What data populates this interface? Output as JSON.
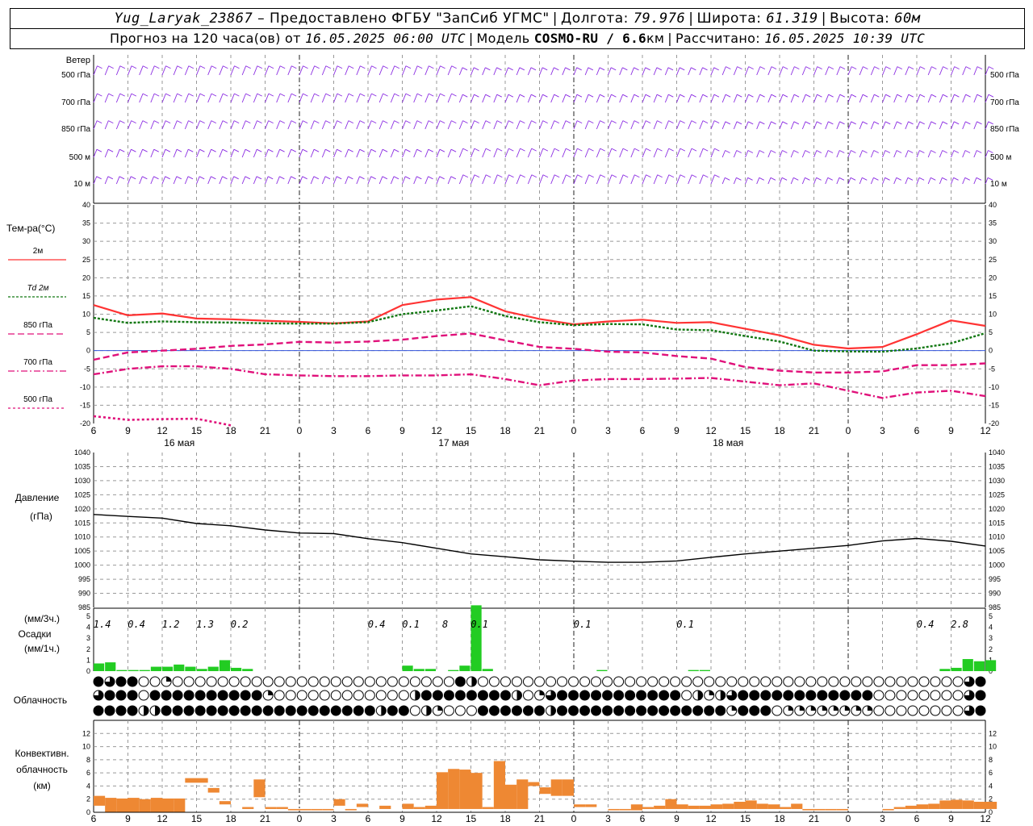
{
  "header": {
    "station": "Yug_Laryak_23867",
    "dash": "–",
    "provider": "Предоставлено ФГБУ \"ЗапСиб УГМС\"",
    "lon_label": "Долгота:",
    "lon": "79.976",
    "lat_label": "Широта:",
    "lat": "61.319",
    "alt_label": "Высота:",
    "alt": "60м",
    "forecast_label": "Прогноз на 120 часа(ов) от",
    "forecast_time": "16.05.2025 06:00 UTC",
    "model_label": "Модель",
    "model": "COSMO-RU / 6.6",
    "model_unit": "км",
    "calc_label": "Рассчитано:",
    "calc_time": "16.05.2025 10:39 UTC"
  },
  "x_axis": {
    "hour_ticks": [
      "6",
      "9",
      "12",
      "15",
      "18",
      "21",
      "0",
      "3",
      "6",
      "9",
      "12",
      "15",
      "18",
      "21",
      "0",
      "3",
      "6",
      "9",
      "12",
      "15",
      "18",
      "21",
      "0",
      "3",
      "6",
      "9",
      "12"
    ],
    "dates": [
      "16 мая",
      "17 мая",
      "18 мая"
    ]
  },
  "colors": {
    "wind": "#8a2be2",
    "temp_2m": "#ff3333",
    "td_2m": "#127812",
    "t850": "#e0107a",
    "precip": "#22cc22",
    "conv": "#ee8833",
    "grid": "#999999"
  },
  "chart_data": [
    {
      "type": "wind_barbs",
      "title": "Ветер",
      "levels": [
        "500 гПа",
        "700 гПа",
        "850 гПа",
        "500 м",
        "10 м"
      ]
    },
    {
      "type": "line",
      "title": "",
      "ylabel": "Тем-ра(°C)",
      "ylim": [
        -20,
        40
      ],
      "y_ticks": [
        "40",
        "35",
        "30",
        "25",
        "20",
        "15",
        "10",
        "5",
        "0",
        "-5",
        "-10",
        "-15",
        "-20"
      ],
      "x_hours": [
        0,
        3,
        6,
        9,
        12,
        15,
        18,
        21,
        24,
        27,
        30,
        33,
        36,
        39,
        42,
        45,
        48,
        51,
        54,
        57,
        60,
        63,
        66,
        69,
        72,
        75,
        78
      ],
      "series": [
        {
          "name": "2м",
          "values": [
            12.5,
            9.7,
            10.2,
            8.8,
            8.6,
            8.2,
            7.9,
            7.5,
            8.0,
            12.5,
            14.0,
            14.7,
            10.8,
            8.7,
            7.2,
            8.0,
            8.5,
            7.6,
            7.8,
            6.0,
            4.2,
            1.6,
            0.6,
            1.0,
            4.5,
            8.3,
            6.8
          ]
        },
        {
          "name": "Td 2м",
          "values": [
            9.0,
            7.6,
            8.0,
            7.8,
            7.7,
            7.5,
            7.4,
            7.4,
            7.8,
            10.0,
            11.0,
            12.2,
            9.5,
            7.8,
            7.0,
            7.3,
            7.2,
            5.8,
            5.6,
            4.0,
            2.5,
            0.0,
            -0.2,
            -0.3,
            0.6,
            2.0,
            4.8
          ]
        },
        {
          "name": "850 гПа",
          "values": [
            -2.5,
            -0.5,
            0.0,
            0.5,
            1.3,
            1.7,
            2.4,
            2.2,
            2.5,
            3.0,
            4.0,
            4.7,
            2.8,
            1.0,
            0.5,
            -0.3,
            -0.5,
            -1.5,
            -2.2,
            -4.5,
            -5.5,
            -6.0,
            -6.0,
            -5.7,
            -4.0,
            -4.0,
            -3.5
          ]
        },
        {
          "name": "700 гПа",
          "values": [
            -6.5,
            -5.0,
            -4.3,
            -4.3,
            -5.0,
            -6.5,
            -6.8,
            -7.0,
            -7.0,
            -6.8,
            -6.8,
            -6.5,
            -7.8,
            -9.5,
            -8.2,
            -7.8,
            -7.8,
            -7.7,
            -7.5,
            -8.5,
            -9.5,
            -9.0,
            -11.0,
            -13.0,
            -11.5,
            -11.0,
            -12.5
          ]
        },
        {
          "name": "500 гПа",
          "values": [
            -18.0,
            -19.0,
            -18.8,
            -18.7,
            -20.5,
            null,
            null,
            null,
            null,
            null,
            null,
            null,
            null,
            null,
            null,
            null,
            null,
            null,
            null,
            null,
            null,
            null,
            null,
            null,
            null,
            null,
            null
          ]
        }
      ]
    },
    {
      "type": "line",
      "title": "",
      "ylabel": "Давление",
      "yunit": "(гПа)",
      "ylim": [
        985,
        1040
      ],
      "y_ticks": [
        "1040",
        "1035",
        "1030",
        "1025",
        "1020",
        "1015",
        "1010",
        "1005",
        "1000",
        "995",
        "990",
        "985"
      ],
      "x_hours": [
        0,
        3,
        6,
        9,
        12,
        15,
        18,
        21,
        24,
        27,
        30,
        33,
        36,
        39,
        42,
        45,
        48,
        51,
        54,
        57,
        60,
        63,
        66,
        69,
        72,
        75,
        78
      ],
      "values": [
        1018,
        1017.3,
        1016.7,
        1014.8,
        1014,
        1012.5,
        1011.4,
        1011.2,
        1009.4,
        1008,
        1006,
        1004,
        1003,
        1001.9,
        1001.4,
        1001,
        1001,
        1001.5,
        1002.8,
        1004,
        1005,
        1006,
        1007,
        1008.6,
        1009.5,
        1008.5,
        1006.8
      ]
    },
    {
      "type": "bar",
      "title": "",
      "ylabel": "Осадки",
      "yunit_3h": "(мм/3ч.)",
      "yunit_1h": "(мм/1ч.)",
      "ylim": [
        0,
        5
      ],
      "y_ticks": [
        "5",
        "4",
        "3",
        "2",
        "1",
        "0"
      ],
      "hourly_values": [
        0.7,
        0.8,
        0.1,
        0.1,
        0.1,
        0.4,
        0.4,
        0.6,
        0.4,
        0.2,
        0.4,
        1.0,
        0.3,
        0.2,
        0,
        0,
        0,
        0,
        0,
        0,
        0,
        0,
        0,
        0,
        0,
        0,
        0,
        0.5,
        0.2,
        0.2,
        0,
        0.1,
        0.5,
        6.1,
        0.2,
        0,
        0,
        0,
        0,
        0,
        0,
        0,
        0,
        0,
        0.1,
        0,
        0,
        0,
        0,
        0,
        0,
        0,
        0.1,
        0.1,
        0,
        0,
        0,
        0,
        0,
        0,
        0,
        0,
        0,
        0,
        0,
        0,
        0,
        0,
        0,
        0,
        0,
        0,
        0,
        0,
        0.2,
        0.3,
        1.1,
        0.9,
        1.0
      ],
      "labels_3h": [
        {
          "hour": 0.75,
          "text": "1.4"
        },
        {
          "hour": 3.75,
          "text": "0.4"
        },
        {
          "hour": 6.75,
          "text": "1.2"
        },
        {
          "hour": 9.75,
          "text": "1.3"
        },
        {
          "hour": 12.75,
          "text": "0.2"
        },
        {
          "hour": 24.75,
          "text": "0.4"
        },
        {
          "hour": 27.75,
          "text": "0.1"
        },
        {
          "hour": 30.75,
          "text": "8"
        },
        {
          "hour": 33.75,
          "text": "0.1"
        },
        {
          "hour": 42.75,
          "text": "0.1"
        },
        {
          "hour": 51.75,
          "text": "0.1"
        },
        {
          "hour": 72.75,
          "text": "0.4"
        },
        {
          "hour": 75.75,
          "text": "2.8"
        }
      ]
    },
    {
      "type": "table",
      "title": "Облачность",
      "rows": [
        [
          8,
          6,
          8,
          8,
          0,
          0,
          2,
          0,
          0,
          0,
          0,
          0,
          0,
          0,
          0,
          0,
          0,
          0,
          0,
          0,
          0,
          0,
          0,
          0,
          0,
          0,
          0,
          0,
          0,
          0,
          0,
          0,
          8,
          4,
          0,
          0,
          0,
          0,
          0,
          0,
          0,
          0,
          0,
          0,
          0,
          0,
          0,
          0,
          0,
          0,
          0,
          0,
          0,
          0,
          0,
          0,
          0,
          0,
          0,
          0,
          0,
          0,
          0,
          0,
          0,
          0,
          0,
          0,
          0,
          0,
          0,
          0,
          0,
          0,
          0,
          0,
          0,
          6,
          8,
          0,
          0,
          0,
          0,
          0,
          0,
          0,
          0,
          0
        ],
        [
          6,
          8,
          8,
          8,
          0,
          8,
          8,
          8,
          8,
          8,
          8,
          8,
          8,
          8,
          8,
          2,
          0,
          0,
          0,
          0,
          0,
          0,
          0,
          0,
          0,
          0,
          0,
          0,
          4,
          8,
          8,
          8,
          8,
          8,
          8,
          8,
          8,
          4,
          0,
          2,
          6,
          8,
          8,
          8,
          8,
          8,
          8,
          8,
          8,
          8,
          8,
          8,
          0,
          4,
          2,
          4,
          6,
          8,
          8,
          8,
          8,
          8,
          8,
          8,
          8,
          8,
          8,
          8,
          8,
          0,
          0,
          0,
          0,
          0,
          0,
          0,
          0,
          6,
          8,
          8,
          8,
          8,
          8,
          8,
          8,
          8,
          8,
          8
        ],
        [
          8,
          8,
          8,
          8,
          4,
          4,
          8,
          8,
          8,
          8,
          8,
          8,
          8,
          8,
          8,
          8,
          8,
          8,
          8,
          8,
          8,
          8,
          8,
          8,
          8,
          4,
          8,
          8,
          0,
          4,
          2,
          0,
          0,
          0,
          8,
          8,
          8,
          8,
          8,
          8,
          4,
          8,
          8,
          8,
          8,
          8,
          8,
          8,
          8,
          8,
          8,
          8,
          8,
          8,
          8,
          8,
          2,
          8,
          8,
          8,
          0,
          2,
          2,
          2,
          2,
          2,
          2,
          2,
          2,
          0,
          0,
          0,
          0,
          0,
          0,
          0,
          0,
          6,
          8,
          8,
          8,
          8,
          8,
          8,
          8,
          8,
          8,
          8
        ]
      ]
    },
    {
      "type": "bar",
      "title": "",
      "ylabel": "Конвективн. облачность",
      "yunit": "(км)",
      "ylim": [
        0,
        14
      ],
      "y_ticks": [
        "12",
        "10",
        "8",
        "6",
        "4",
        "2",
        "0"
      ],
      "bars": [
        {
          "h": 0,
          "base": 1.0,
          "top": 2.5
        },
        {
          "h": 1,
          "base": 0,
          "top": 2.2
        },
        {
          "h": 2,
          "base": 0,
          "top": 2.1
        },
        {
          "h": 3,
          "base": 0,
          "top": 2.2
        },
        {
          "h": 4,
          "base": 0,
          "top": 2.0
        },
        {
          "h": 5,
          "base": 0,
          "top": 2.2
        },
        {
          "h": 6,
          "base": 0,
          "top": 2.1
        },
        {
          "h": 7,
          "base": 0,
          "top": 2.1
        },
        {
          "h": 8,
          "base": 4.5,
          "top": 5.2
        },
        {
          "h": 9,
          "base": 4.5,
          "top": 5.2
        },
        {
          "h": 10,
          "base": 3.0,
          "top": 3.7
        },
        {
          "h": 11,
          "base": 1.2,
          "top": 1.7
        },
        {
          "h": 13,
          "base": 0.5,
          "top": 0.8
        },
        {
          "h": 14,
          "base": 2.3,
          "top": 5.0
        },
        {
          "h": 15,
          "base": 0.5,
          "top": 0.8
        },
        {
          "h": 16,
          "base": 0.5,
          "top": 0.8
        },
        {
          "h": 17,
          "base": 0.3,
          "top": 0.5
        },
        {
          "h": 18,
          "base": 0.3,
          "top": 0.5
        },
        {
          "h": 19,
          "base": 0.3,
          "top": 0.5
        },
        {
          "h": 20,
          "base": 0.3,
          "top": 0.5
        },
        {
          "h": 21,
          "base": 1.0,
          "top": 2.0
        },
        {
          "h": 22,
          "base": 0.3,
          "top": 0.5
        },
        {
          "h": 23,
          "base": 0.8,
          "top": 1.3
        },
        {
          "h": 25,
          "base": 0.5,
          "top": 1.0
        },
        {
          "h": 27,
          "base": 0.5,
          "top": 1.3
        },
        {
          "h": 28,
          "base": 0.5,
          "top": 0.8
        },
        {
          "h": 29,
          "base": 0.5,
          "top": 1.0
        },
        {
          "h": 30,
          "base": 0.5,
          "top": 6.1
        },
        {
          "h": 31,
          "base": 0.5,
          "top": 6.6
        },
        {
          "h": 32,
          "base": 0.5,
          "top": 6.5
        },
        {
          "h": 33,
          "base": 0.5,
          "top": 6.0
        },
        {
          "h": 34,
          "base": 0.5,
          "top": 0.8
        },
        {
          "h": 35,
          "base": 0.5,
          "top": 7.8
        },
        {
          "h": 36,
          "base": 0.5,
          "top": 4.2
        },
        {
          "h": 37,
          "base": 0.5,
          "top": 5.0
        },
        {
          "h": 38,
          "base": 4.0,
          "top": 4.6
        },
        {
          "h": 39,
          "base": 2.8,
          "top": 3.8
        },
        {
          "h": 40,
          "base": 2.5,
          "top": 5.0
        },
        {
          "h": 41,
          "base": 2.5,
          "top": 5.0
        },
        {
          "h": 42,
          "base": 0.8,
          "top": 1.2
        },
        {
          "h": 43,
          "base": 0.8,
          "top": 1.2
        },
        {
          "h": 45,
          "base": 0.3,
          "top": 0.5
        },
        {
          "h": 46,
          "base": 0.3,
          "top": 0.5
        },
        {
          "h": 47,
          "base": 0.3,
          "top": 1.2
        },
        {
          "h": 48,
          "base": 0.5,
          "top": 0.8
        },
        {
          "h": 49,
          "base": 0.5,
          "top": 1.0
        },
        {
          "h": 50,
          "base": 0.5,
          "top": 2.0
        },
        {
          "h": 51,
          "base": 0.5,
          "top": 1.2
        },
        {
          "h": 52,
          "base": 0.5,
          "top": 1.0
        },
        {
          "h": 53,
          "base": 0.5,
          "top": 1.0
        },
        {
          "h": 54,
          "base": 0.5,
          "top": 1.2
        },
        {
          "h": 55,
          "base": 0.5,
          "top": 1.3
        },
        {
          "h": 56,
          "base": 0.5,
          "top": 1.6
        },
        {
          "h": 57,
          "base": 0.5,
          "top": 1.8
        },
        {
          "h": 58,
          "base": 0.5,
          "top": 1.3
        },
        {
          "h": 59,
          "base": 0.5,
          "top": 1.2
        },
        {
          "h": 60,
          "base": 0.5,
          "top": 0.8
        },
        {
          "h": 61,
          "base": 0.5,
          "top": 1.3
        },
        {
          "h": 62,
          "base": 0.3,
          "top": 0.5
        },
        {
          "h": 63,
          "base": 0.3,
          "top": 0.5
        },
        {
          "h": 64,
          "base": 0.3,
          "top": 0.5
        },
        {
          "h": 65,
          "base": 0.3,
          "top": 0.5
        },
        {
          "h": 69,
          "base": 0.3,
          "top": 0.5
        },
        {
          "h": 70,
          "base": 0.5,
          "top": 0.8
        },
        {
          "h": 71,
          "base": 0.5,
          "top": 1.0
        },
        {
          "h": 72,
          "base": 0.5,
          "top": 1.2
        },
        {
          "h": 73,
          "base": 0.5,
          "top": 1.3
        },
        {
          "h": 74,
          "base": 0.5,
          "top": 1.8
        },
        {
          "h": 75,
          "base": 0.5,
          "top": 1.9
        },
        {
          "h": 76,
          "base": 0.5,
          "top": 1.8
        },
        {
          "h": 77,
          "base": 0.5,
          "top": 1.6
        },
        {
          "h": 78,
          "base": 0.5,
          "top": 1.6
        }
      ]
    }
  ]
}
